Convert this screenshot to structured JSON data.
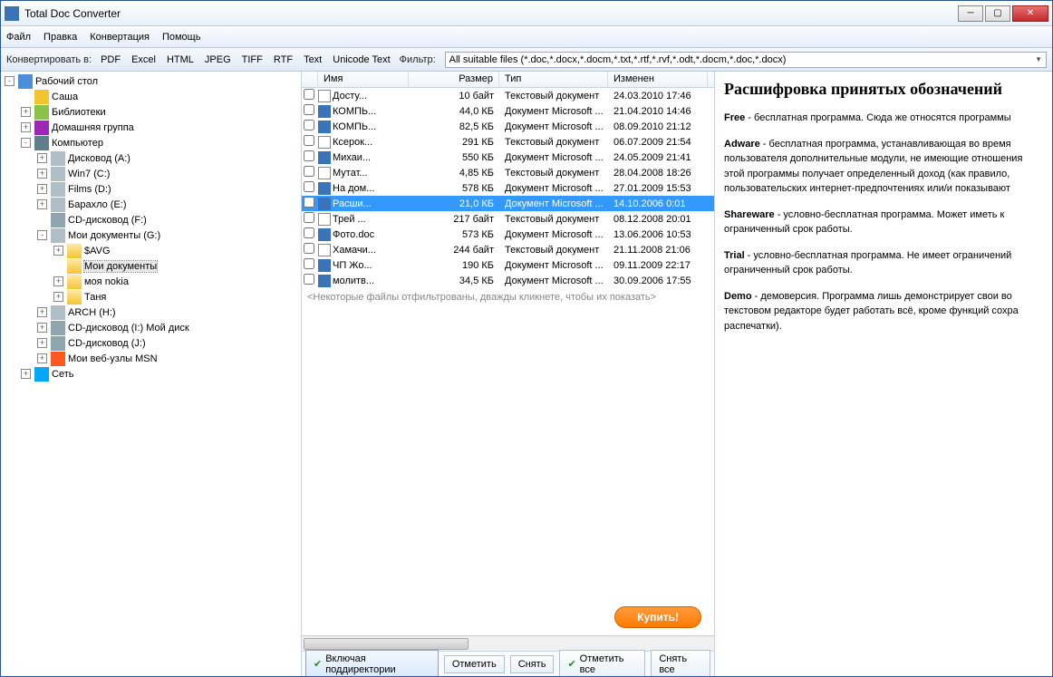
{
  "title": "Total Doc Converter",
  "menu": [
    "Файл",
    "Правка",
    "Конвертация",
    "Помощь"
  ],
  "toolbar": {
    "convert_label": "Конвертировать в:",
    "formats": [
      "PDF",
      "Excel",
      "HTML",
      "JPEG",
      "TIFF",
      "RTF",
      "Text",
      "Unicode Text"
    ],
    "filter_label": "Фильтр:",
    "filter_value": "All suitable files (*.doc,*.docx,*.docm,*.txt,*.rtf,*.rvf,*.odt,*.docm,*.doc,*.docx)"
  },
  "tree": [
    {
      "depth": 0,
      "exp": "-",
      "icon": "desktop",
      "label": "Рабочий стол"
    },
    {
      "depth": 1,
      "exp": " ",
      "icon": "user",
      "label": "Саша"
    },
    {
      "depth": 1,
      "exp": "+",
      "icon": "lib",
      "label": "Библиотеки"
    },
    {
      "depth": 1,
      "exp": "+",
      "icon": "group",
      "label": "Домашняя группа"
    },
    {
      "depth": 1,
      "exp": "-",
      "icon": "comp",
      "label": "Компьютер"
    },
    {
      "depth": 2,
      "exp": "+",
      "icon": "drive",
      "label": "Дисковод (A:)"
    },
    {
      "depth": 2,
      "exp": "+",
      "icon": "drive",
      "label": "Win7 (C:)"
    },
    {
      "depth": 2,
      "exp": "+",
      "icon": "drive",
      "label": "Films (D:)"
    },
    {
      "depth": 2,
      "exp": "+",
      "icon": "drive",
      "label": "Барахло (E:)"
    },
    {
      "depth": 2,
      "exp": " ",
      "icon": "disc",
      "label": "CD-дисковод (F:)"
    },
    {
      "depth": 2,
      "exp": "-",
      "icon": "drive",
      "label": "Мои документы (G:)"
    },
    {
      "depth": 3,
      "exp": "+",
      "icon": "folder",
      "label": "$AVG"
    },
    {
      "depth": 3,
      "exp": " ",
      "icon": "folder",
      "label": "Мои документы",
      "sel": true
    },
    {
      "depth": 3,
      "exp": "+",
      "icon": "folder",
      "label": "моя nokia"
    },
    {
      "depth": 3,
      "exp": "+",
      "icon": "folder",
      "label": "Таня"
    },
    {
      "depth": 2,
      "exp": "+",
      "icon": "drive",
      "label": "ARCH (H:)"
    },
    {
      "depth": 2,
      "exp": "+",
      "icon": "disc",
      "label": "CD-дисковод (I:) Мой диск"
    },
    {
      "depth": 2,
      "exp": "+",
      "icon": "disc",
      "label": "CD-дисковод (J:)"
    },
    {
      "depth": 2,
      "exp": "+",
      "icon": "msn",
      "label": "Мои веб-узлы MSN"
    },
    {
      "depth": 1,
      "exp": "+",
      "icon": "net",
      "label": "Сеть"
    }
  ],
  "columns": {
    "name": "Имя",
    "size": "Размер",
    "type": "Тип",
    "modified": "Изменен"
  },
  "files": [
    {
      "icon": "doc",
      "name": "Досту...",
      "size": "10 байт",
      "type": "Текстовый документ",
      "mod": "24.03.2010 17:46"
    },
    {
      "icon": "word",
      "name": "КОМПЬ...",
      "size": "44,0 КБ",
      "type": "Документ Microsoft ...",
      "mod": "21.04.2010 14:46"
    },
    {
      "icon": "word",
      "name": "КОМПЬ...",
      "size": "82,5 КБ",
      "type": "Документ Microsoft ...",
      "mod": "08.09.2010 21:12"
    },
    {
      "icon": "doc",
      "name": "Ксерок...",
      "size": "291 КБ",
      "type": "Текстовый документ",
      "mod": "06.07.2009 21:54"
    },
    {
      "icon": "word",
      "name": "Михаи...",
      "size": "550 КБ",
      "type": "Документ Microsoft ...",
      "mod": "24.05.2009 21:41"
    },
    {
      "icon": "doc",
      "name": "Мутат...",
      "size": "4,85 КБ",
      "type": "Текстовый документ",
      "mod": "28.04.2008 18:26"
    },
    {
      "icon": "word",
      "name": "На дом...",
      "size": "578 КБ",
      "type": "Документ Microsoft ...",
      "mod": "27.01.2009 15:53"
    },
    {
      "icon": "word",
      "name": "Расши...",
      "size": "21,0 КБ",
      "type": "Документ Microsoft ...",
      "mod": "14.10.2006 0:01",
      "sel": true
    },
    {
      "icon": "doc",
      "name": "Трей ...",
      "size": "217 байт",
      "type": "Текстовый документ",
      "mod": "08.12.2008 20:01"
    },
    {
      "icon": "word",
      "name": "Фото.doc",
      "size": "573 КБ",
      "type": "Документ Microsoft ...",
      "mod": "13.06.2006 10:53"
    },
    {
      "icon": "doc",
      "name": "Хамачи...",
      "size": "244 байт",
      "type": "Текстовый документ",
      "mod": "21.11.2008 21:06"
    },
    {
      "icon": "word",
      "name": "ЧП Жо...",
      "size": "190 КБ",
      "type": "Документ Microsoft ...",
      "mod": "09.11.2009 22:17"
    },
    {
      "icon": "word",
      "name": "молитв...",
      "size": "34,5 КБ",
      "type": "Документ Microsoft ...",
      "mod": "30.09.2006 17:55"
    }
  ],
  "filter_msg": "<Некоторые файлы отфильтрованы, дважды кликнете, чтобы их показать>",
  "buy": "Купить!",
  "bottom": {
    "subdirs": "Включая поддиректории",
    "check": "Отметить",
    "uncheck": "Снять",
    "check_all": "Отметить все",
    "uncheck_all": "Снять все"
  },
  "preview": {
    "title": "Расшифровка принятых обозначений",
    "paras": [
      {
        "b": "Free",
        "t": " - бесплатная программа. Сюда же относятся программы"
      },
      {
        "b": "Adware",
        "t": " - бесплатная программа, устанавливающая во время пользователя дополнительные модули, не имеющие отношения этой программы получает определенный доход (как правило, пользовательских интернет-предпочтениях или/и показывают"
      },
      {
        "b": "Shareware",
        "t": " - условно-бесплатная программа. Может иметь к ограниченный срок работы."
      },
      {
        "b": "Trial",
        "t": " - условно-бесплатная программа. Не имеет ограничений ограниченный срок работы."
      },
      {
        "b": "Demo",
        "t": " - демоверсия. Программа лишь демонстрирует свои во текстовом редакторе будет работать всё, кроме функций сохра распечатки)."
      }
    ]
  }
}
